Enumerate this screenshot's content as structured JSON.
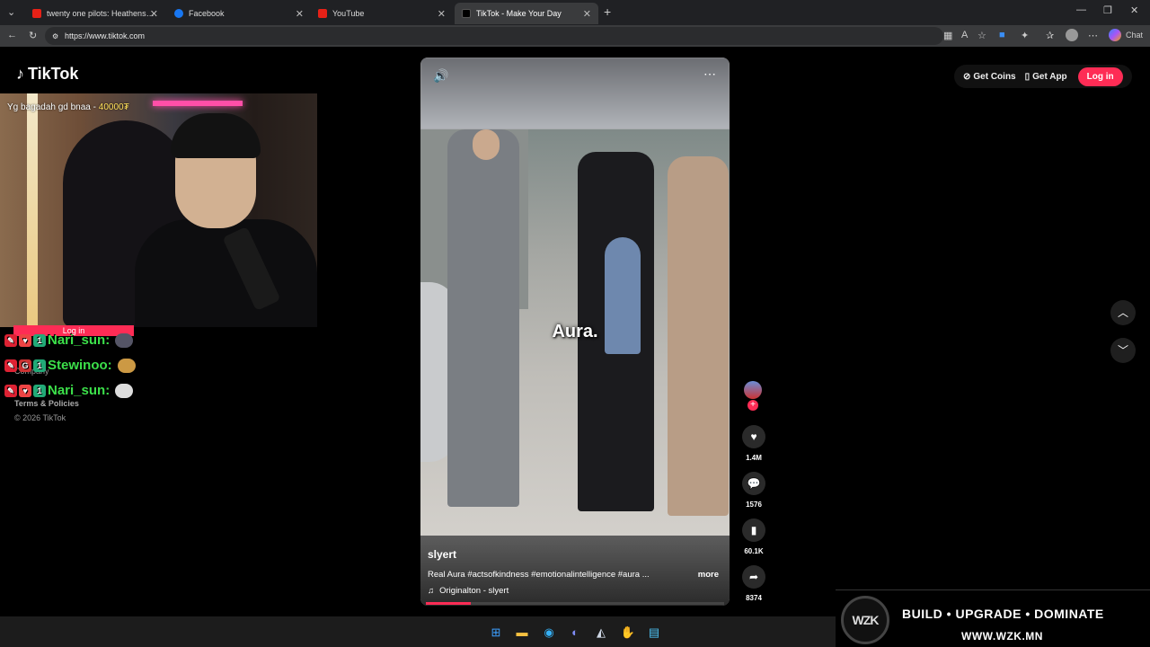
{
  "browser": {
    "tabs": [
      {
        "title": "twenty one pilots: Heathens (from",
        "icon": "youtube-favicon",
        "active": false
      },
      {
        "title": "Facebook",
        "icon": "facebook-favicon",
        "active": false
      },
      {
        "title": "YouTube",
        "icon": "youtube-favicon",
        "active": false
      },
      {
        "title": "TikTok - Make Your Day",
        "icon": "tiktok-favicon",
        "active": true
      }
    ],
    "new_tab_icon": "+",
    "url": "https://www.tiktok.com",
    "chat_label": "Chat",
    "window_controls": [
      "—",
      "❐",
      "✕"
    ]
  },
  "tiktok": {
    "logo_text": "TikTok",
    "sidebar_links": {
      "company": "Company",
      "terms": "Terms & Policies",
      "copyright": "© 2026 TikTok"
    },
    "header": {
      "get_coins": "Get Coins",
      "get_app": "Get App",
      "login": "Log in"
    },
    "video": {
      "caption_overlay": "Aura.",
      "author": "slyert",
      "description": "Real Aura #actsofkindness #emotionalintelligence #aura ...",
      "more_label": "more",
      "music": "Originalton - slyert",
      "progress": 0.15
    },
    "actions": {
      "likes": "1.4M",
      "comments": "1576",
      "saves": "60.1K",
      "shares": "8374"
    }
  },
  "stream_overlay": {
    "ticker_text": "Yg bagadah gd bnaa - ",
    "ticker_amount": "40000₮",
    "login_bar": "Log in",
    "chat": [
      {
        "user": "Nari_sun:",
        "color": "#3ce04a"
      },
      {
        "user": "Stewinoo:",
        "color": "#3ce04a"
      },
      {
        "user": "Nari_sun:",
        "color": "#3ce04a"
      }
    ]
  },
  "banner": {
    "logo": "WZK",
    "tagline": "BUILD • UPGRADE • DOMINATE",
    "url": "WWW.WZK.MN"
  },
  "colors": {
    "accent": "#fe2c55",
    "background": "#000000"
  }
}
